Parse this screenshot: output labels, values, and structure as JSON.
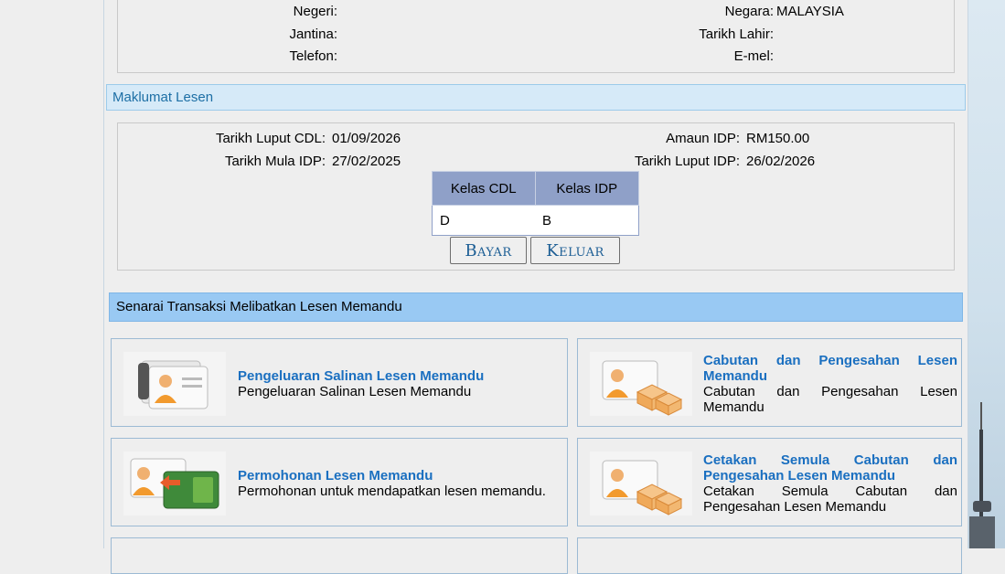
{
  "personal": {
    "negeri_label": "Negeri:",
    "negeri_value": "",
    "negara_label": "Negara:",
    "negara_value": "MALAYSIA",
    "jantina_label": "Jantina:",
    "jantina_value": "",
    "tarikh_lahir_label": "Tarikh Lahir:",
    "tarikh_lahir_value": "",
    "telefon_label": "Telefon:",
    "telefon_value": "",
    "emel_label": "E-mel:",
    "emel_value": ""
  },
  "lesen": {
    "section_title": "Maklumat Lesen",
    "tarikh_luput_cdl_label": "Tarikh Luput CDL:",
    "tarikh_luput_cdl_value": "01/09/2026",
    "amaun_idp_label": "Amaun IDP:",
    "amaun_idp_value": "RM150.00",
    "tarikh_mula_idp_label": "Tarikh Mula IDP:",
    "tarikh_mula_idp_value": "27/02/2025",
    "tarikh_luput_idp_label": "Tarikh Luput IDP:",
    "tarikh_luput_idp_value": "26/02/2026",
    "table": {
      "headers": [
        "Kelas CDL",
        "Kelas IDP"
      ],
      "rows": [
        [
          "D",
          "B"
        ]
      ]
    },
    "bayar_label": "Bayar",
    "keluar_label": "Keluar"
  },
  "transaksi": {
    "section_title": "Senarai Transaksi Melibatkan Lesen Memandu",
    "cards": [
      {
        "title": "Pengeluaran Salinan Lesen Memandu",
        "desc": "Pengeluaran Salinan Lesen Memandu",
        "icon": "license-card-icon"
      },
      {
        "title": "Cabutan dan Pengesahan Lesen Memandu",
        "desc": "Cabutan dan Pengesahan Lesen Memandu",
        "icon": "license-boxes-icon"
      },
      {
        "title": "Permohonan Lesen Memandu",
        "desc": "Permohonan untuk mendapatkan lesen memandu.",
        "icon": "license-apply-icon"
      },
      {
        "title": "Cetakan Semula Cabutan dan Pengesahan Lesen Memandu",
        "desc": "Cetakan Semula Cabutan dan Pengesahan Lesen Memandu",
        "icon": "license-boxes-icon"
      }
    ]
  },
  "colors": {
    "section_bar": "#d6eaf8",
    "section_bar_dark": "#99c9f3",
    "table_header": "#8fa0c8",
    "link_blue": "#1a6fc0"
  }
}
